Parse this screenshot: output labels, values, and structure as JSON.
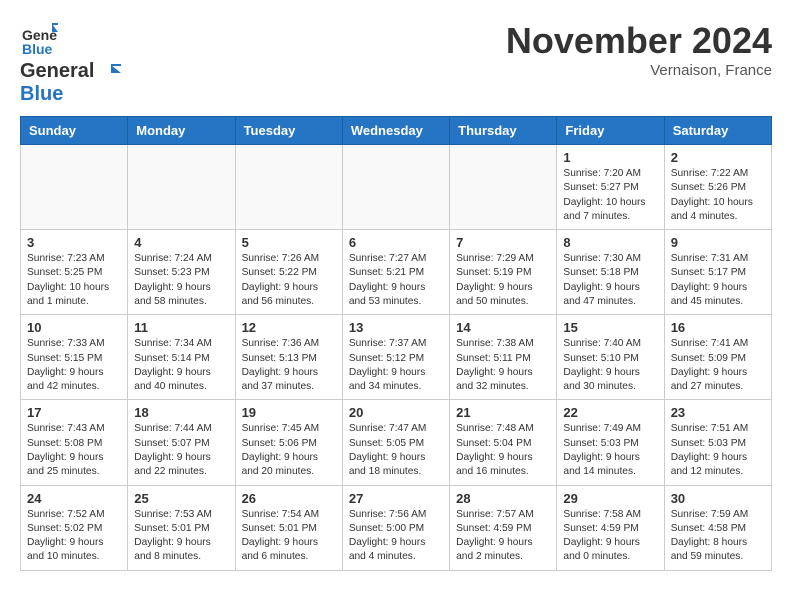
{
  "header": {
    "logo_line1": "General",
    "logo_line2": "Blue",
    "month_title": "November 2024",
    "location": "Vernaison, France"
  },
  "calendar": {
    "days_of_week": [
      "Sunday",
      "Monday",
      "Tuesday",
      "Wednesday",
      "Thursday",
      "Friday",
      "Saturday"
    ],
    "weeks": [
      [
        {
          "day": "",
          "info": ""
        },
        {
          "day": "",
          "info": ""
        },
        {
          "day": "",
          "info": ""
        },
        {
          "day": "",
          "info": ""
        },
        {
          "day": "",
          "info": ""
        },
        {
          "day": "1",
          "info": "Sunrise: 7:20 AM\nSunset: 5:27 PM\nDaylight: 10 hours\nand 7 minutes."
        },
        {
          "day": "2",
          "info": "Sunrise: 7:22 AM\nSunset: 5:26 PM\nDaylight: 10 hours\nand 4 minutes."
        }
      ],
      [
        {
          "day": "3",
          "info": "Sunrise: 7:23 AM\nSunset: 5:25 PM\nDaylight: 10 hours\nand 1 minute."
        },
        {
          "day": "4",
          "info": "Sunrise: 7:24 AM\nSunset: 5:23 PM\nDaylight: 9 hours\nand 58 minutes."
        },
        {
          "day": "5",
          "info": "Sunrise: 7:26 AM\nSunset: 5:22 PM\nDaylight: 9 hours\nand 56 minutes."
        },
        {
          "day": "6",
          "info": "Sunrise: 7:27 AM\nSunset: 5:21 PM\nDaylight: 9 hours\nand 53 minutes."
        },
        {
          "day": "7",
          "info": "Sunrise: 7:29 AM\nSunset: 5:19 PM\nDaylight: 9 hours\nand 50 minutes."
        },
        {
          "day": "8",
          "info": "Sunrise: 7:30 AM\nSunset: 5:18 PM\nDaylight: 9 hours\nand 47 minutes."
        },
        {
          "day": "9",
          "info": "Sunrise: 7:31 AM\nSunset: 5:17 PM\nDaylight: 9 hours\nand 45 minutes."
        }
      ],
      [
        {
          "day": "10",
          "info": "Sunrise: 7:33 AM\nSunset: 5:15 PM\nDaylight: 9 hours\nand 42 minutes."
        },
        {
          "day": "11",
          "info": "Sunrise: 7:34 AM\nSunset: 5:14 PM\nDaylight: 9 hours\nand 40 minutes."
        },
        {
          "day": "12",
          "info": "Sunrise: 7:36 AM\nSunset: 5:13 PM\nDaylight: 9 hours\nand 37 minutes."
        },
        {
          "day": "13",
          "info": "Sunrise: 7:37 AM\nSunset: 5:12 PM\nDaylight: 9 hours\nand 34 minutes."
        },
        {
          "day": "14",
          "info": "Sunrise: 7:38 AM\nSunset: 5:11 PM\nDaylight: 9 hours\nand 32 minutes."
        },
        {
          "day": "15",
          "info": "Sunrise: 7:40 AM\nSunset: 5:10 PM\nDaylight: 9 hours\nand 30 minutes."
        },
        {
          "day": "16",
          "info": "Sunrise: 7:41 AM\nSunset: 5:09 PM\nDaylight: 9 hours\nand 27 minutes."
        }
      ],
      [
        {
          "day": "17",
          "info": "Sunrise: 7:43 AM\nSunset: 5:08 PM\nDaylight: 9 hours\nand 25 minutes."
        },
        {
          "day": "18",
          "info": "Sunrise: 7:44 AM\nSunset: 5:07 PM\nDaylight: 9 hours\nand 22 minutes."
        },
        {
          "day": "19",
          "info": "Sunrise: 7:45 AM\nSunset: 5:06 PM\nDaylight: 9 hours\nand 20 minutes."
        },
        {
          "day": "20",
          "info": "Sunrise: 7:47 AM\nSunset: 5:05 PM\nDaylight: 9 hours\nand 18 minutes."
        },
        {
          "day": "21",
          "info": "Sunrise: 7:48 AM\nSunset: 5:04 PM\nDaylight: 9 hours\nand 16 minutes."
        },
        {
          "day": "22",
          "info": "Sunrise: 7:49 AM\nSunset: 5:03 PM\nDaylight: 9 hours\nand 14 minutes."
        },
        {
          "day": "23",
          "info": "Sunrise: 7:51 AM\nSunset: 5:03 PM\nDaylight: 9 hours\nand 12 minutes."
        }
      ],
      [
        {
          "day": "24",
          "info": "Sunrise: 7:52 AM\nSunset: 5:02 PM\nDaylight: 9 hours\nand 10 minutes."
        },
        {
          "day": "25",
          "info": "Sunrise: 7:53 AM\nSunset: 5:01 PM\nDaylight: 9 hours\nand 8 minutes."
        },
        {
          "day": "26",
          "info": "Sunrise: 7:54 AM\nSunset: 5:01 PM\nDaylight: 9 hours\nand 6 minutes."
        },
        {
          "day": "27",
          "info": "Sunrise: 7:56 AM\nSunset: 5:00 PM\nDaylight: 9 hours\nand 4 minutes."
        },
        {
          "day": "28",
          "info": "Sunrise: 7:57 AM\nSunset: 4:59 PM\nDaylight: 9 hours\nand 2 minutes."
        },
        {
          "day": "29",
          "info": "Sunrise: 7:58 AM\nSunset: 4:59 PM\nDaylight: 9 hours\nand 0 minutes."
        },
        {
          "day": "30",
          "info": "Sunrise: 7:59 AM\nSunset: 4:58 PM\nDaylight: 8 hours\nand 59 minutes."
        }
      ]
    ]
  }
}
